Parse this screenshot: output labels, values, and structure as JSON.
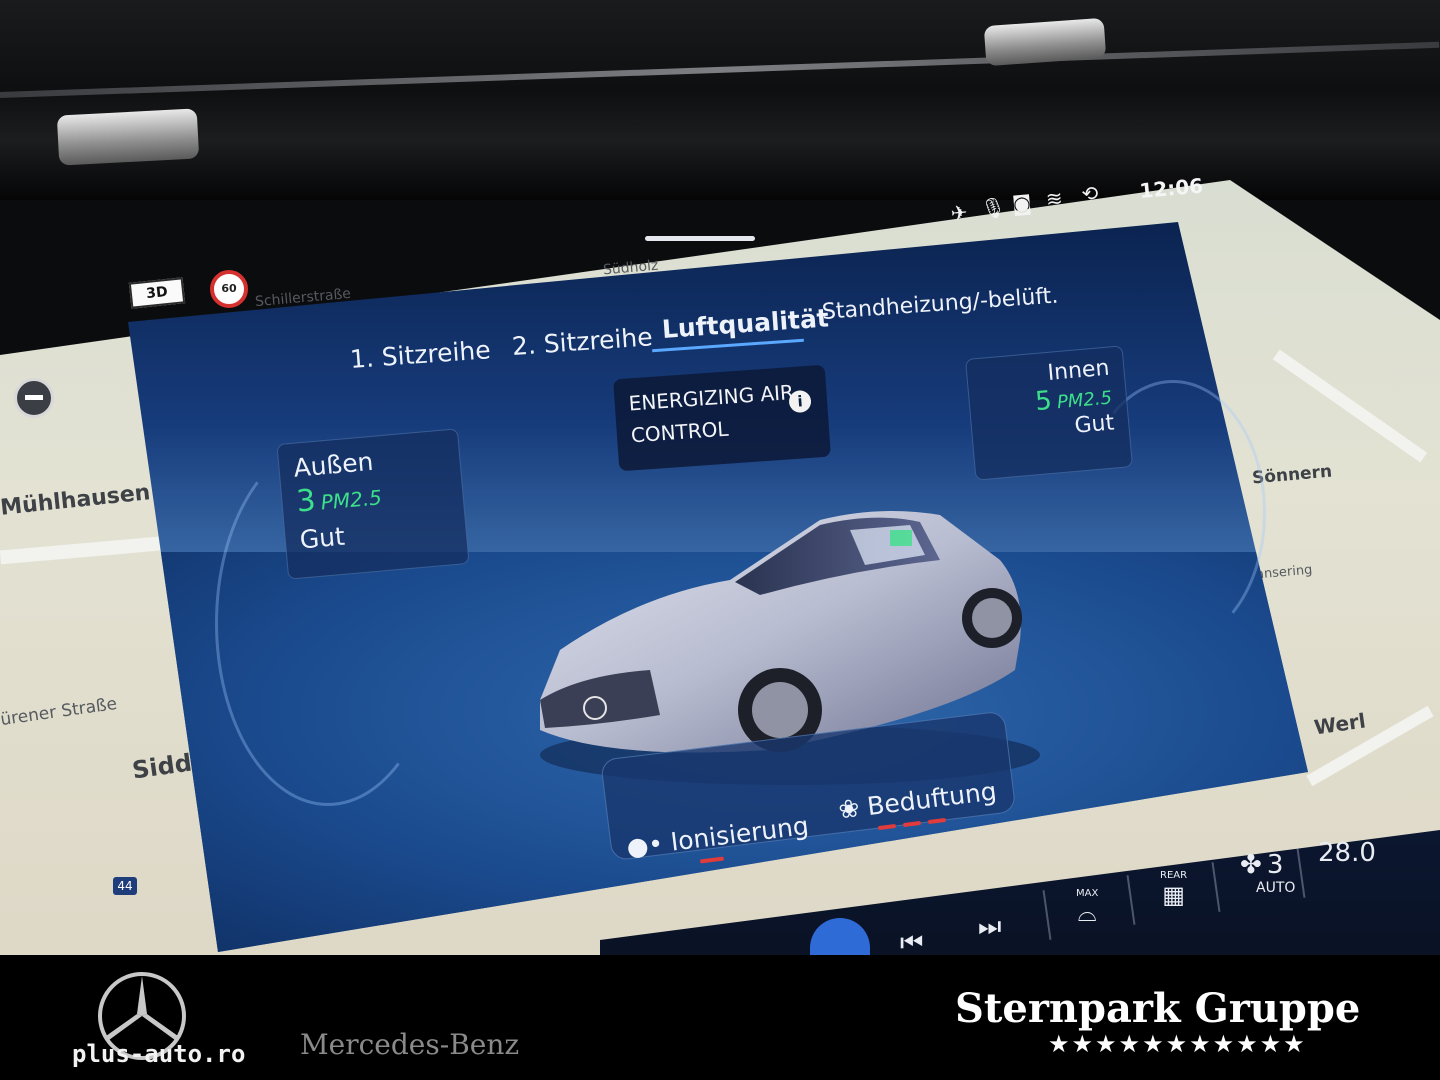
{
  "status_bar": {
    "time": "12:06"
  },
  "map": {
    "mode_button": "3D",
    "speed_limit": "60",
    "labels": {
      "schillerstrasse": "Schillerstraße",
      "suedholz": "Südholz",
      "muehlhausen": "Mühlhausen",
      "duerener_strasse": "ürener Straße",
      "siddi": "Siddi",
      "soennern": "Sönnern",
      "ansering": "ansering",
      "werl": "Werl"
    },
    "highway": "44"
  },
  "tabs": [
    {
      "label": "1. Sitzreihe"
    },
    {
      "label": "2. Sitzreihe"
    },
    {
      "label": "Luftqualität",
      "active": true
    },
    {
      "label": "Standheizung/-belüft."
    }
  ],
  "energizing": {
    "label_line1": "ENERGIZING AIR",
    "label_line2": "CONTROL",
    "info": "i"
  },
  "outside": {
    "title": "Außen",
    "value": "3",
    "unit": "PM2.5",
    "status": "Gut"
  },
  "inside": {
    "title": "Innen",
    "value": "5",
    "unit": "PM2.5",
    "status": "Gut"
  },
  "functions": {
    "ionisierung": "Ionisierung",
    "beduftung": "Beduftung"
  },
  "climate": {
    "max_label": "MAX",
    "rear_label": "REAR",
    "fan_level": "3",
    "fan_mode": "AUTO",
    "temperature": "28.0"
  },
  "branding": {
    "site": "plus-auto.ro",
    "mercedes": "Mercedes-Benz",
    "dealer": "Sternpark Gruppe",
    "stars": "★★★★★★★★★★★"
  },
  "colors": {
    "accent_green": "#3de08a",
    "indicator_red": "#e23b3b",
    "tab_underline": "#5aa8ff"
  }
}
